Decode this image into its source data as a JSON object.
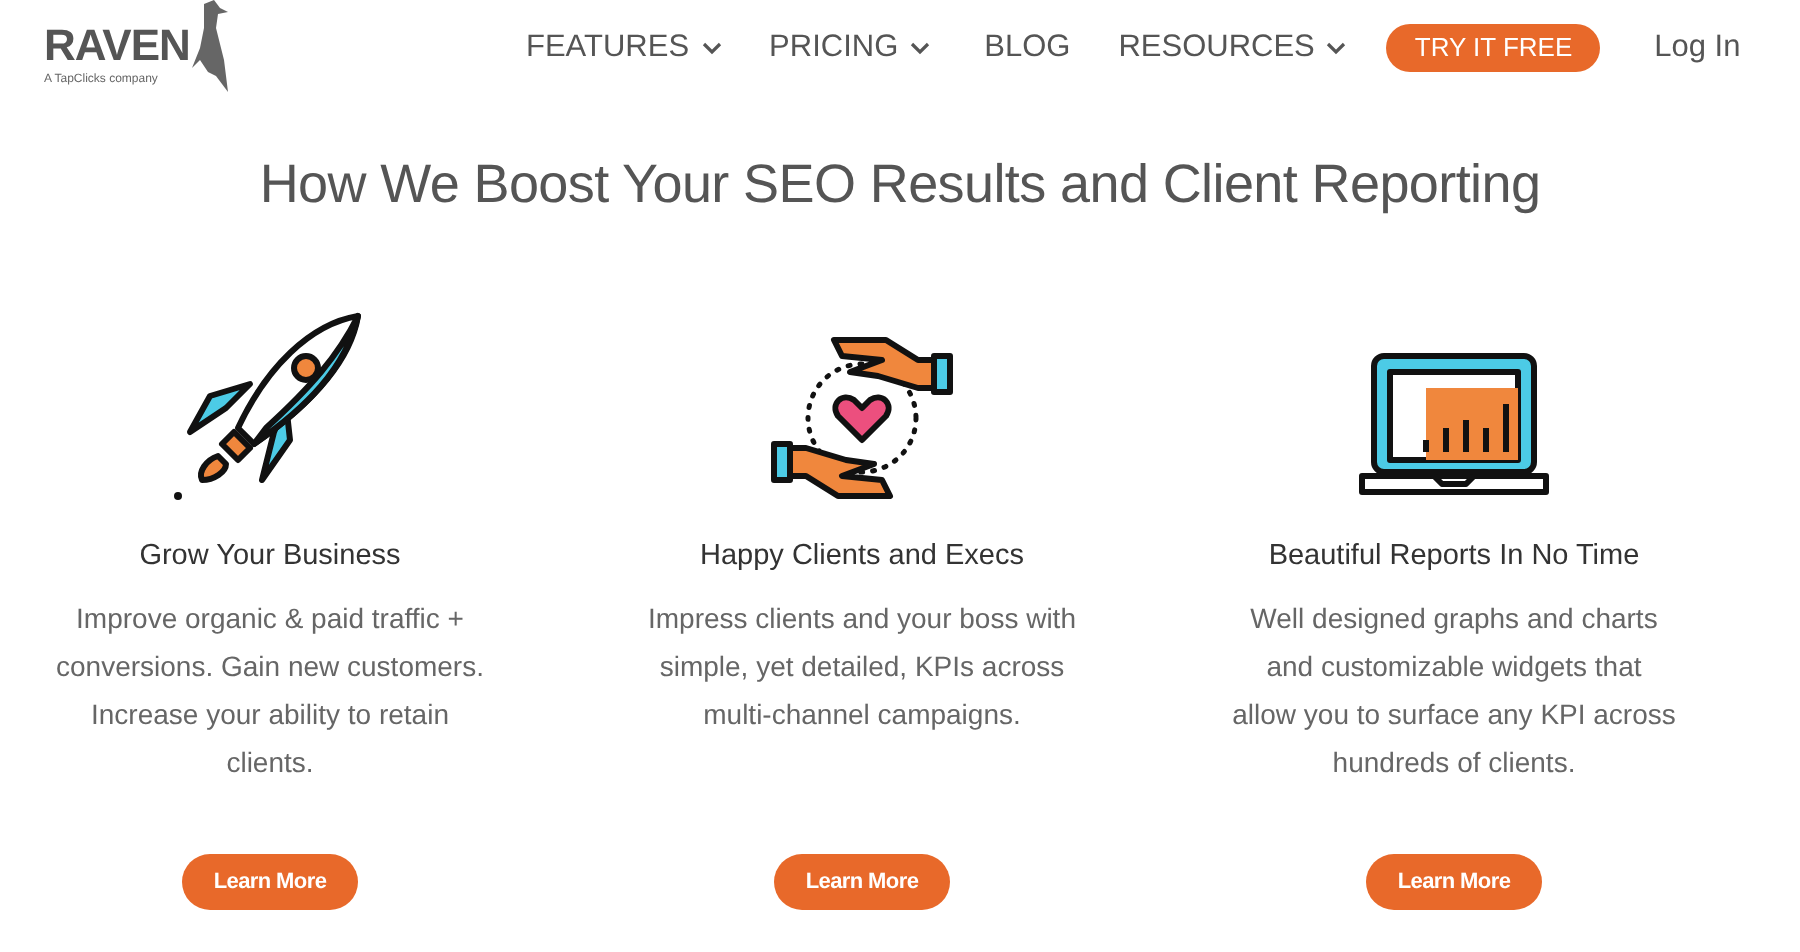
{
  "header": {
    "logo": {
      "name": "RAVEN",
      "tagline": "A TapClicks company"
    },
    "nav": [
      {
        "label": "FEATURES",
        "dropdown": true
      },
      {
        "label": "PRICING",
        "dropdown": true
      },
      {
        "label": "BLOG",
        "dropdown": false
      },
      {
        "label": "RESOURCES",
        "dropdown": true
      }
    ],
    "cta": "TRY IT FREE",
    "login": "Log In"
  },
  "heading": "How We Boost Your SEO Results and Client Reporting",
  "features": [
    {
      "kind": "rocket",
      "title": "Grow Your Business",
      "description": "Improve organic & paid traffic + conversions. Gain new customers. Increase your ability to retain clients.",
      "button": "Learn More"
    },
    {
      "kind": "hands",
      "title": "Happy Clients and Execs",
      "description": "Impress clients and your boss with simple, yet detailed, KPIs across multi-channel campaigns.",
      "button": "Learn More"
    },
    {
      "kind": "laptop",
      "title": "Beautiful Reports In No Time",
      "description": "Well designed graphs and charts and customizable widgets that allow you to surface any KPI across hundreds of clients.",
      "button": "Learn More"
    }
  ]
}
